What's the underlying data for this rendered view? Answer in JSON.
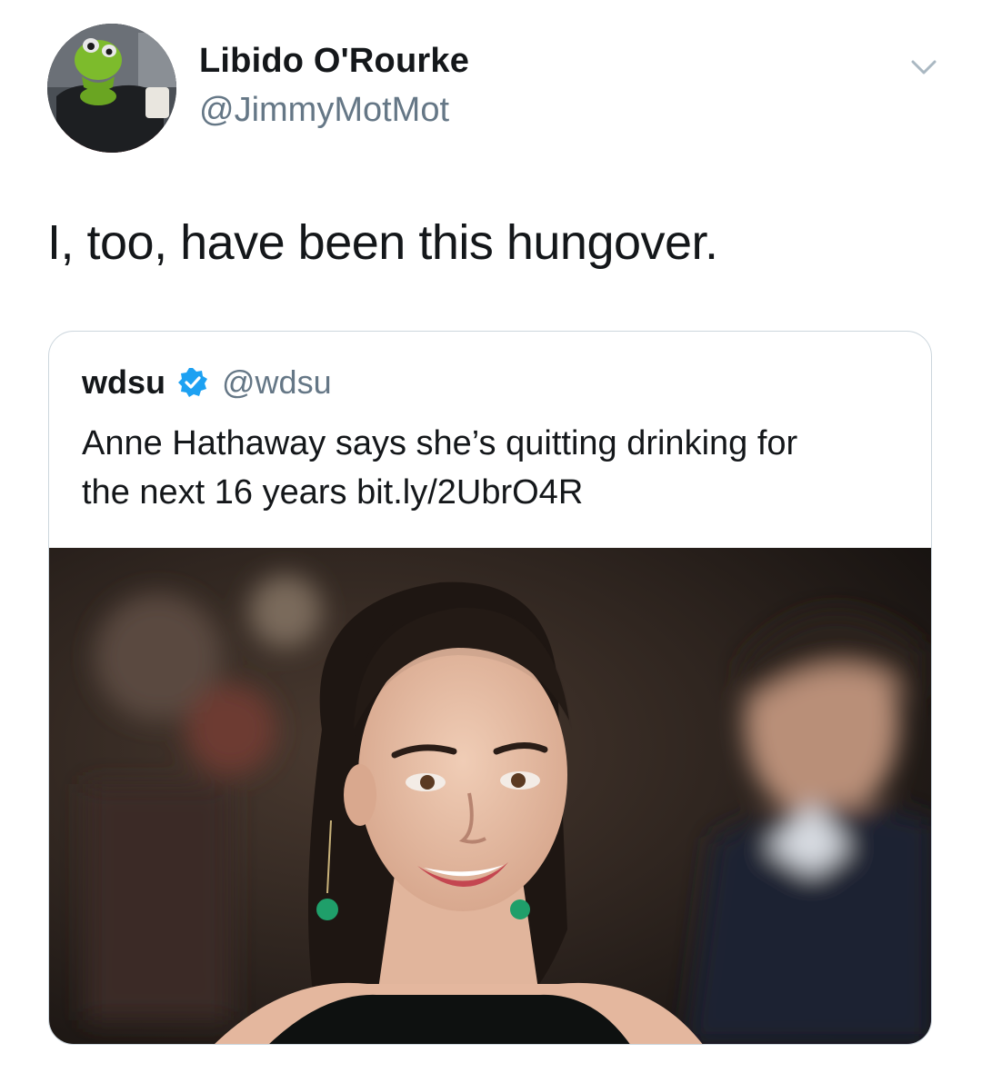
{
  "tweet": {
    "author": {
      "display_name": "Libido O'Rourke",
      "handle": "@JimmyMotMot",
      "avatar_icon": "kermit-avatar"
    },
    "menu_icon": "chevron-down-icon",
    "text": "I, too, have been this hungover."
  },
  "quoted_tweet": {
    "display_name": "wdsu",
    "verified": true,
    "verified_icon": "verified-badge-icon",
    "handle": "@wdsu",
    "text_line1": "Anne Hathaway says she’s quitting drinking for",
    "text_line2": "the next 16 years bit.ly/2UbrO4R",
    "photo": "woman-smiling-red-carpet-photo"
  },
  "colors": {
    "text_primary": "#14171a",
    "text_secondary": "#657786",
    "card_border": "#ccd6dd",
    "verified_blue": "#1da1f2"
  }
}
